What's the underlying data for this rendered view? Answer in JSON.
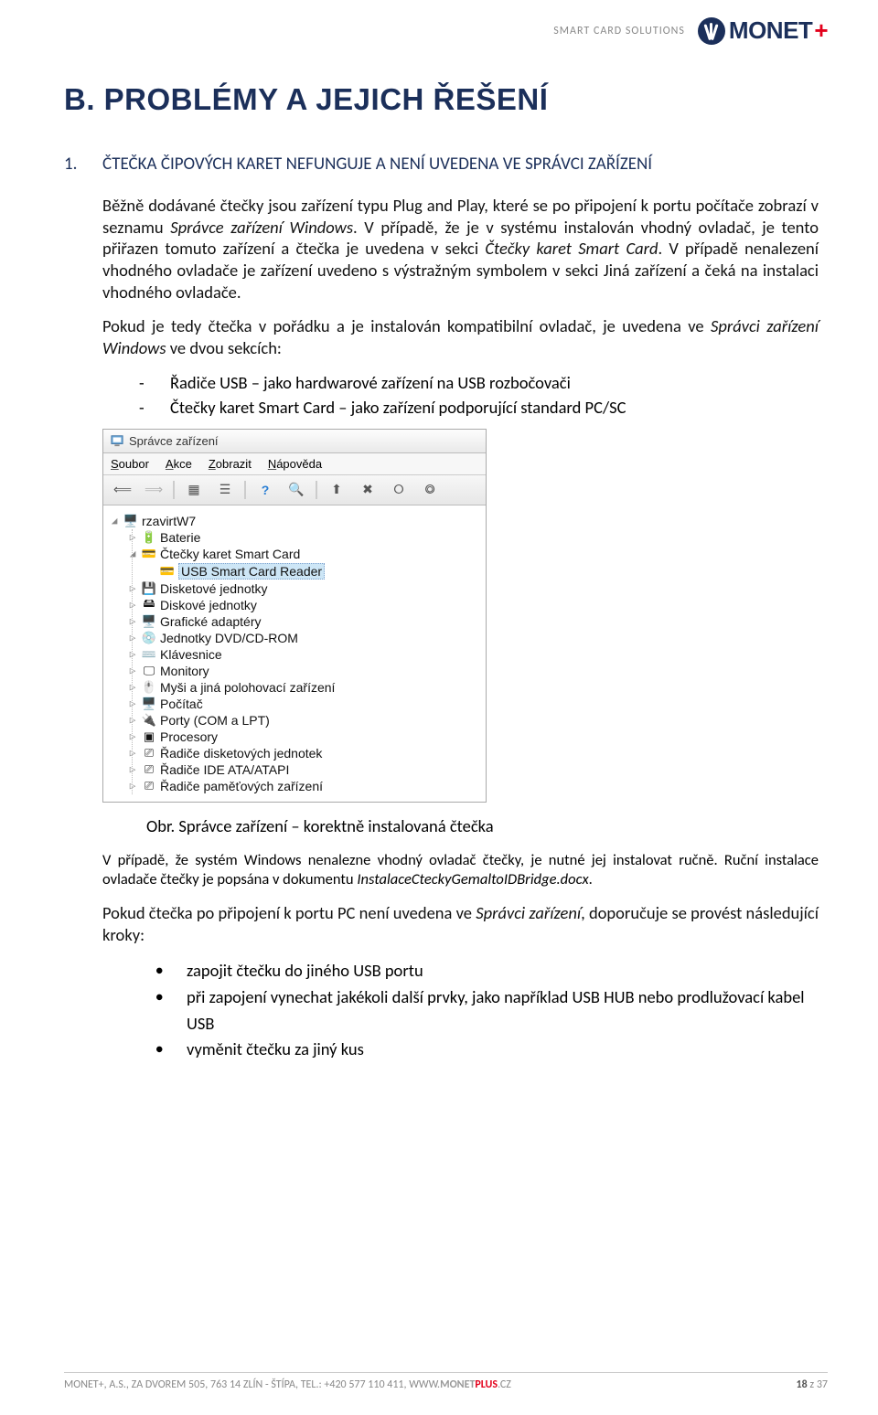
{
  "header": {
    "tagline": "SMART CARD SOLUTIONS",
    "logo_text": "MONET",
    "logo_plus": "+"
  },
  "section_title": "B. PROBLÉMY A JEJICH ŘEŠENÍ",
  "sub_num": "1.",
  "sub_title": "ČTEČKA ČIPOVÝCH KARET NEFUNGUJE A NENÍ UVEDENA VE SPRÁVCI ZAŘÍZENÍ",
  "para1a": "Běžně dodávané čtečky jsou zařízení typu Plug and Play, které se po připojení k portu počítače zobrazí v seznamu ",
  "para1b": "Správce zařízení Windows",
  "para1c": ". V případě, že je v systému instalován vhodný ovladač, je tento přiřazen tomuto zařízení a čtečka je uvedena v sekci ",
  "para1d": "Čtečky karet Smart Card",
  "para1e": ". V případě nenalezení vhodného ovladače je zařízení uvedeno s výstražným symbolem v sekci Jiná zařízení a čeká na instalaci vhodného ovladače.",
  "para2a": "Pokud je tedy čtečka v pořádku a je instalován kompatibilní ovladač, je uvedena ve ",
  "para2b": "Správci zařízení Windows",
  "para2c": " ve dvou sekcích:",
  "list1": "Řadiče USB – jako hardwarové zařízení na USB rozbočovači",
  "list2": "Čtečky karet Smart Card – jako zařízení podporující standard PC/SC",
  "devmgr": {
    "title": "Správce zařízení",
    "menu": {
      "m1": "Soubor",
      "m2": "Akce",
      "m3": "Zobrazit",
      "m4": "Nápověda"
    },
    "root": "rzavirtW7",
    "items": [
      "Baterie",
      "Čtečky karet Smart Card",
      "USB Smart Card Reader",
      "Disketové jednotky",
      "Diskové jednotky",
      "Grafické adaptéry",
      "Jednotky DVD/CD-ROM",
      "Klávesnice",
      "Monitory",
      "Myši a jiná polohovací zařízení",
      "Počítač",
      "Porty (COM a LPT)",
      "Procesory",
      "Řadiče disketových jednotek",
      "Řadiče IDE ATA/ATAPI",
      "Řadiče paměťových zařízení"
    ]
  },
  "caption": "Obr. Správce zařízení – korektně instalovaná čtečka",
  "para3a": "V případě, že systém Windows nenalezne vhodný ovladač čtečky, je nutné jej instalovat ručně. Ruční instalace ovladače čtečky je popsána v dokumentu ",
  "para3b": "InstalaceCteckyGemaltoIDBridge.docx",
  "para3c": ".",
  "para4a": "Pokud čtečka po připojení k portu PC není uvedena ve ",
  "para4b": "Správci zařízení",
  "para4c": ", doporučuje se provést následující kroky:",
  "b1": "zapojit čtečku do jiného USB portu",
  "b2": "při zapojení vynechat jakékoli další prvky, jako například USB HUB nebo prodlužovací kabel USB",
  "b3": "vyměnit čtečku za jiný kus",
  "footer": {
    "left_a": "MONET+, A.S., ZA DVOREM 505, 763 14 ZLÍN - ŠTÍPA, TEL.: +420 577 110 411, WWW.",
    "left_b": "MONET",
    "left_c": "PLUS",
    "left_d": ".CZ",
    "page_cur": "18",
    "page_sep": " z ",
    "page_tot": "37"
  }
}
